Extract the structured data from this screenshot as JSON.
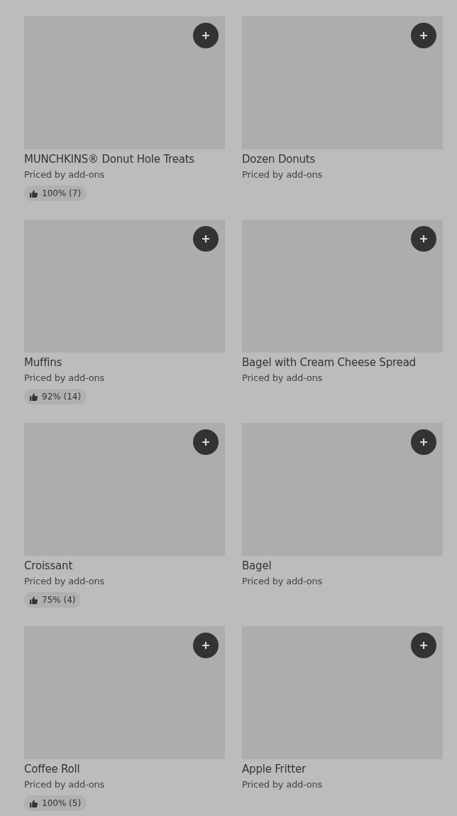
{
  "items": [
    {
      "name": "MUNCHKINS® Donut Hole Treats",
      "price": "Priced by add-ons",
      "rating": "100% (7)"
    },
    {
      "name": "Dozen Donuts",
      "price": "Priced by add-ons"
    },
    {
      "name": "Muffins",
      "price": "Priced by add-ons",
      "rating": "92% (14)"
    },
    {
      "name": "Bagel with Cream Cheese Spread",
      "price": "Priced by add-ons"
    },
    {
      "name": "Croissant",
      "price": "Priced by add-ons",
      "rating": "75% (4)"
    },
    {
      "name": "Bagel",
      "price": "Priced by add-ons"
    },
    {
      "name": "Coffee Roll",
      "price": "Priced by add-ons",
      "rating": "100% (5)"
    },
    {
      "name": "Apple Fritter",
      "price": "Priced by add-ons"
    }
  ]
}
